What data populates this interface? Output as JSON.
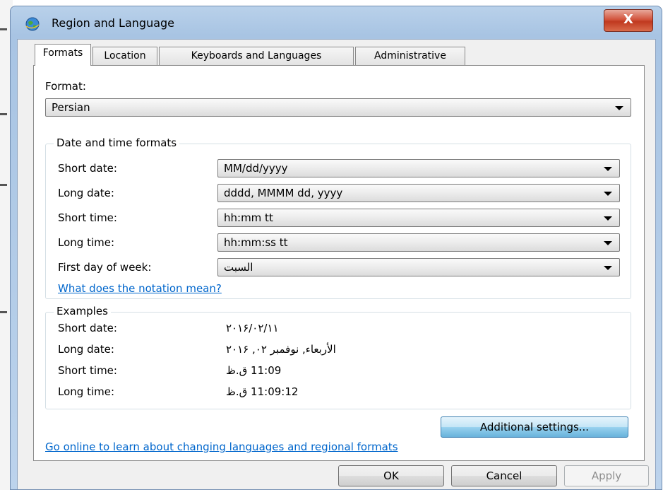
{
  "window": {
    "title": "Region and Language",
    "close_label": "X"
  },
  "tabs": [
    {
      "label": "Formats"
    },
    {
      "label": "Location"
    },
    {
      "label": "Keyboards and Languages"
    },
    {
      "label": "Administrative"
    }
  ],
  "format": {
    "label": "Format:",
    "value": "Persian"
  },
  "date_time": {
    "title": "Date and time formats",
    "rows": [
      {
        "label": "Short date:",
        "value": "MM/dd/yyyy"
      },
      {
        "label": "Long date:",
        "value": "dddd, MMMM dd, yyyy"
      },
      {
        "label": "Short time:",
        "value": "hh:mm tt"
      },
      {
        "label": "Long time:",
        "value": "hh:mm:ss tt"
      },
      {
        "label": "First day of week:",
        "value": "السبت"
      }
    ],
    "notation_link": "What does the notation mean?"
  },
  "examples": {
    "title": "Examples",
    "rows": [
      {
        "label": "Short date:",
        "value": "٢٠١۶/٠٢/١١"
      },
      {
        "label": "Long date:",
        "value": "الأربعاء, نوفمبر ٠٢, ٢٠١۶"
      },
      {
        "label": "Short time:",
        "value": "11:09 ق.ظ"
      },
      {
        "label": "Long time:",
        "value": "11:09:12 ق.ظ"
      }
    ]
  },
  "additional_settings_label": "Additional settings...",
  "online_link": "Go online to learn about changing languages and regional formats",
  "buttons": {
    "ok": "OK",
    "cancel": "Cancel",
    "apply": "Apply"
  }
}
